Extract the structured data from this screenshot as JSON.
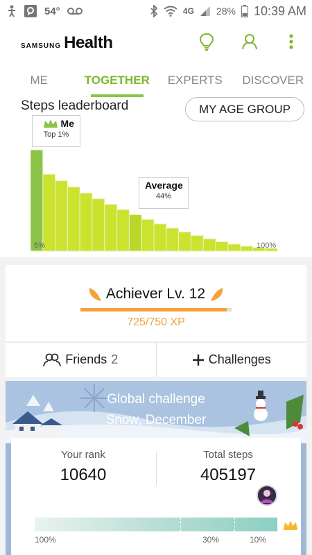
{
  "status_bar": {
    "temperature": "54°",
    "network": "4G",
    "battery": "28%",
    "time": "10:39 AM"
  },
  "header": {
    "brand_small": "SAMSUNG",
    "brand_big": "Health",
    "icons": [
      "lightbulb-icon",
      "person-icon",
      "more-vert-icon"
    ],
    "accent_color": "#8bc34a"
  },
  "tabs": [
    {
      "label": "ME",
      "active": false
    },
    {
      "label": "TOGETHER",
      "active": true
    },
    {
      "label": "EXPERTS",
      "active": false
    },
    {
      "label": "DISCOVER",
      "active": false
    }
  ],
  "leaderboard": {
    "title": "Steps leaderboard",
    "age_group_button": "MY AGE GROUP",
    "me": {
      "label": "Me",
      "rank": "Top 1%"
    },
    "average": {
      "label": "Average",
      "value": "44%"
    },
    "axis_start": "5%",
    "axis_end": "100%"
  },
  "achiever": {
    "title": "Achiever Lv. 12",
    "xp": "725/750 XP",
    "progress": 0.9667,
    "accent_color": "#f5a03c"
  },
  "actions": {
    "friends_label": "Friends",
    "friends_count": "2",
    "challenges_label": "Challenges"
  },
  "challenge": {
    "title": "Global challenge",
    "subtitle": "Snow, December",
    "rank_label": "Your rank",
    "rank_value": "10640",
    "steps_label": "Total steps",
    "steps_value": "405197",
    "scale": [
      "100%",
      "30%",
      "10%"
    ]
  }
}
